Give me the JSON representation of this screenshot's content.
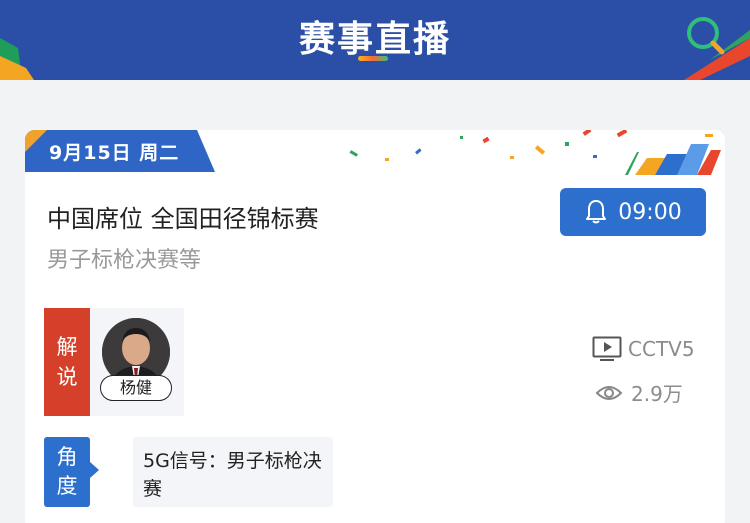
{
  "header": {
    "title": "赛事直播",
    "search_icon": "search-icon"
  },
  "date_tab": {
    "label": "9月15日 周二"
  },
  "event": {
    "title": "中国席位 全国田径锦标赛",
    "subtitle": "男子标枪决赛等"
  },
  "reminder": {
    "icon": "bell-icon",
    "time": "09:00"
  },
  "commentary": {
    "label_line1": "解",
    "label_line2": "说",
    "commentator_name": "杨健"
  },
  "channel": {
    "icon": "tv-play-icon",
    "name": "CCTV5"
  },
  "views": {
    "icon": "eye-icon",
    "count": "2.9万"
  },
  "angle": {
    "label_line1": "角",
    "label_line2": "度",
    "options": [
      "5G信号：男子标枪决赛"
    ]
  },
  "colors": {
    "header_bg": "#2b4fa6",
    "primary_blue": "#2d6fcc",
    "commentary_red": "#d5402b",
    "date_tab_blue": "#2f66c6",
    "date_tab_orange": "#f0a22a"
  }
}
